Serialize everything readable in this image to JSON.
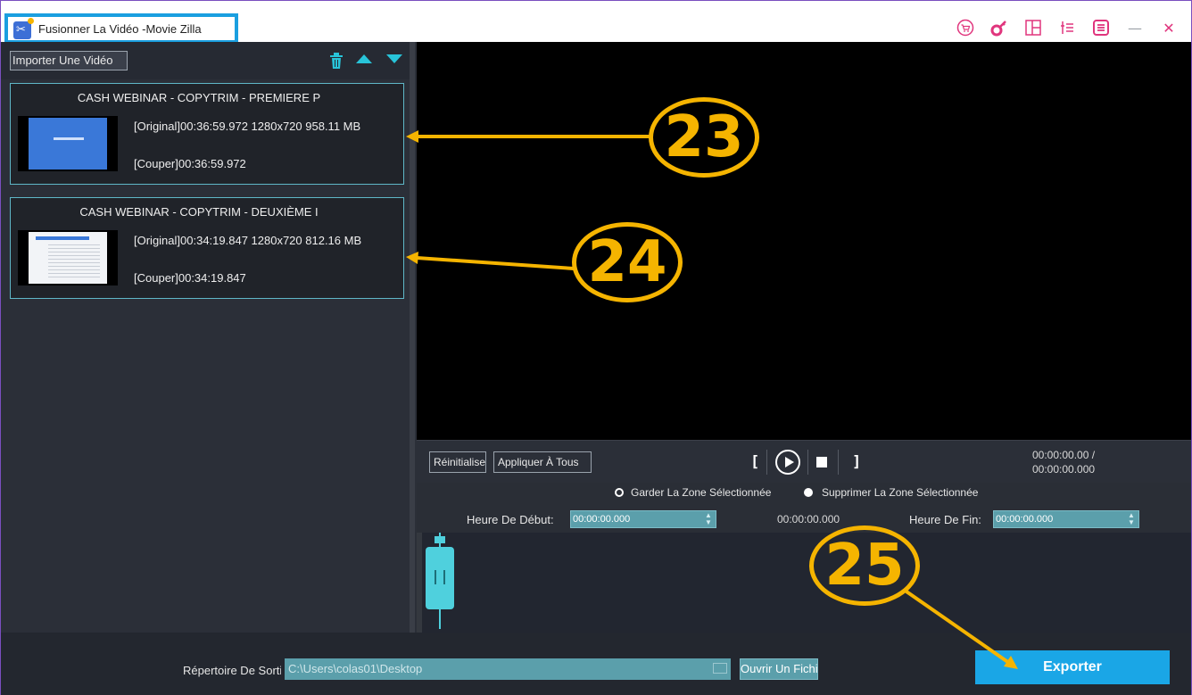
{
  "window": {
    "title": "Fusionner La Vidéo -Movie Zilla",
    "toolbar_icons": [
      "cart-icon",
      "key-icon",
      "layout-icon",
      "list-settings-icon",
      "menu-icon",
      "minimize-icon",
      "close-icon"
    ],
    "minimize_glyph": "—",
    "close_glyph": "✕"
  },
  "left_panel": {
    "import_label": "Importer Une Vidéo",
    "clips": [
      {
        "title": "CASH WEBINAR - COPYTRIM - PREMIERE P",
        "original": "[Original]00:36:59.972 1280x720 958.11 MB",
        "cut": "[Couper]00:36:59.972"
      },
      {
        "title": "CASH WEBINAR - COPYTRIM - DEUXIÈME I",
        "original": "[Original]00:34:19.847 1280x720 812.16 MB",
        "cut": "[Couper]00:34:19.847"
      }
    ]
  },
  "controls": {
    "reset_label": "Réinitialiser",
    "apply_all_label": "Appliquer À Tous",
    "bracket_left": "[",
    "bracket_right": "]",
    "time_current": "00:00:00.00 /",
    "time_total": "00:00:00.000",
    "keep_label": "Garder La Zone Sélectionnée",
    "delete_label": "Supprimer La Zone Sélectionnée",
    "start_label": "Heure De Début:",
    "start_value": "00:00:00.000",
    "mid_time": "00:00:00.000",
    "end_label": "Heure De Fin:",
    "end_value": "00:00:00.000",
    "spin_up": "▲",
    "spin_down": "▼"
  },
  "bottom": {
    "output_label": "Répertoire De Sortie",
    "output_path": "C:\\Users\\colas01\\Desktop",
    "open_label": "Ouvrir Un Fichier",
    "export_label": "Exporter"
  },
  "annotations": [
    "23",
    "24",
    "25"
  ],
  "colors": {
    "accent": "#1aa6e6",
    "annotation": "#f5b400",
    "toolbar_icon": "#e0357d",
    "teal": "#28c4d9"
  }
}
